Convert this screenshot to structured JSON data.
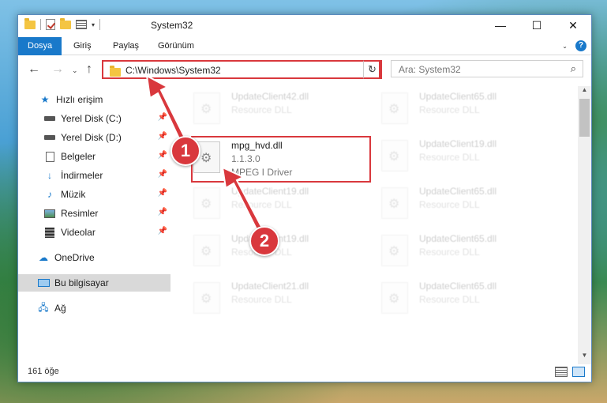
{
  "window": {
    "title": "System32"
  },
  "ribbon": {
    "tabs": [
      "Dosya",
      "Giriş",
      "Paylaş",
      "Görünüm"
    ]
  },
  "nav": {
    "address": "C:\\Windows\\System32",
    "search_placeholder": "Ara: System32"
  },
  "sidebar": {
    "items": [
      {
        "label": "Hızlı erişim",
        "icon": "star-icon"
      },
      {
        "label": "Yerel Disk (C:)",
        "icon": "drive-icon"
      },
      {
        "label": "Yerel Disk (D:)",
        "icon": "drive-icon"
      },
      {
        "label": "Belgeler",
        "icon": "documents-icon"
      },
      {
        "label": "İndirmeler",
        "icon": "downloads-icon"
      },
      {
        "label": "Müzik",
        "icon": "music-icon"
      },
      {
        "label": "Resimler",
        "icon": "pictures-icon"
      },
      {
        "label": "Videolar",
        "icon": "videos-icon"
      },
      {
        "label": "OneDrive",
        "icon": "cloud-icon"
      },
      {
        "label": "Bu bilgisayar",
        "icon": "computer-icon"
      },
      {
        "label": "Ağ",
        "icon": "network-icon"
      }
    ]
  },
  "files": [
    {
      "name": "UpdateClient42.dll",
      "desc": "Resource DLL"
    },
    {
      "name": "UpdateClient65.dll",
      "desc": "Resource DLL"
    },
    {
      "name": "mpg_hvd.dll",
      "version": "1.1.3.0",
      "desc": "MPEG I Driver"
    },
    {
      "name": "UpdateClient19.dll",
      "desc": "Resource DLL"
    },
    {
      "name": "UpdateClient19.dll",
      "desc": "Resource DLL"
    },
    {
      "name": "UpdateClient65.dll",
      "desc": "Resource DLL"
    },
    {
      "name": "UpdateClient19.dll",
      "desc": "Resource DLL"
    },
    {
      "name": "UpdateClient65.dll",
      "desc": "Resource DLL"
    },
    {
      "name": "UpdateClient21.dll",
      "desc": "Resource DLL"
    },
    {
      "name": "UpdateClient65.dll",
      "desc": "Resource DLL"
    }
  ],
  "status": {
    "count": "161 öğe"
  },
  "annotations": {
    "step1": "1",
    "step2": "2"
  },
  "colors": {
    "accent": "#1979ca",
    "highlight": "#d9383d"
  }
}
